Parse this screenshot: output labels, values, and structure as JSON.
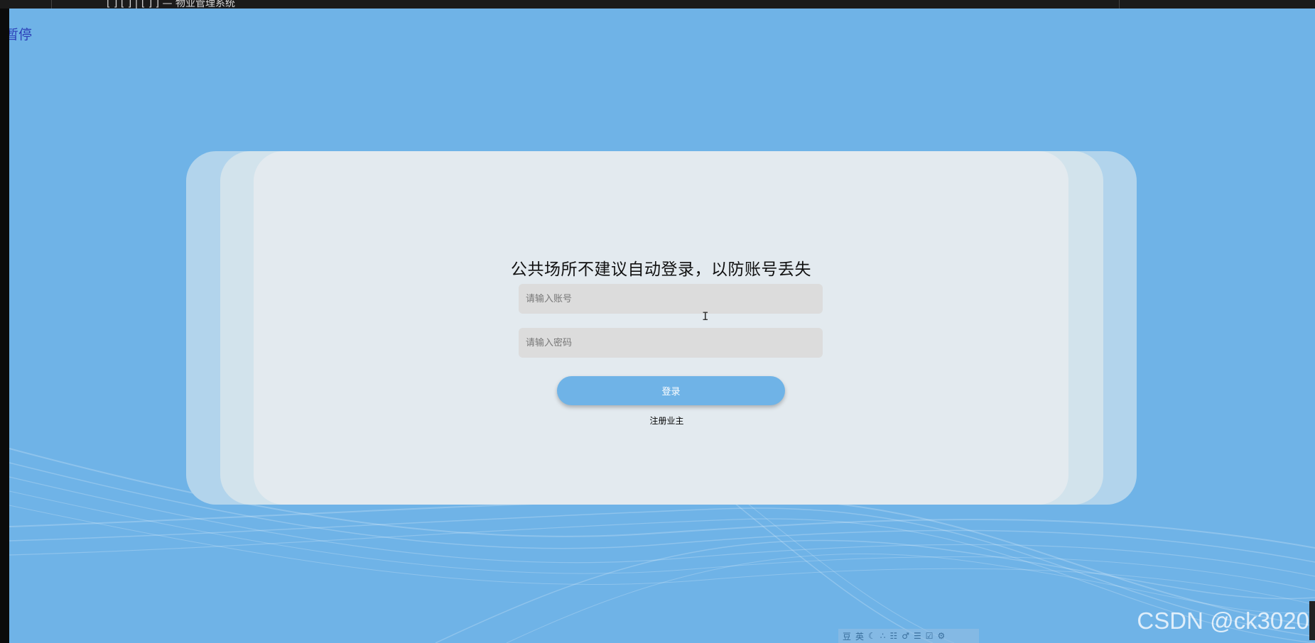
{
  "topbar": {
    "title": "[  ]  [  ] |  [  ]  ]  —  物业管理系统"
  },
  "corner_text": "暂停",
  "login": {
    "title": "公共场所不建议自动登录，以防账号丢失",
    "account_placeholder": "请输入账号",
    "password_placeholder": "请输入密码",
    "login_button": "登录",
    "register_link": "注册业主"
  },
  "watermark": "CSDN @ck3020",
  "ime_toolbar": {
    "items": [
      "豆",
      "英",
      "☾",
      "∴",
      "☷",
      "♂",
      "☰",
      "☑",
      "⚙"
    ]
  },
  "colors": {
    "background": "#6fb3e7",
    "card": "#e3eaef",
    "button": "#6fb3e7",
    "corner_text": "#2b3fb8"
  }
}
